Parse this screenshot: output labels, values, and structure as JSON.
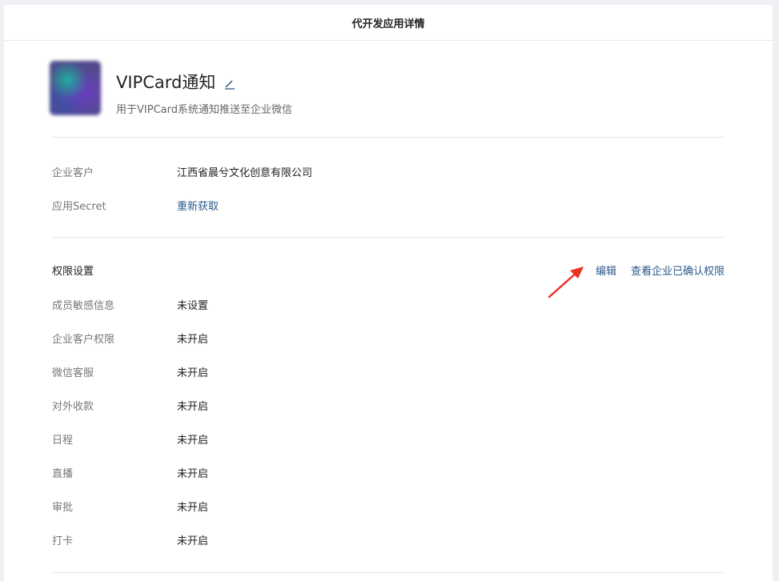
{
  "header": {
    "title": "代开发应用详情"
  },
  "app": {
    "name": "VIPCard通知",
    "description": "用于VIPCard系统通知推送至企业微信"
  },
  "info": [
    {
      "label": "企业客户",
      "value": "江西省晨兮文化创意有限公司",
      "link": false
    },
    {
      "label": "应用Secret",
      "value": "重新获取",
      "link": true
    }
  ],
  "permissions": {
    "title": "权限设置",
    "edit_label": "编辑",
    "view_label": "查看企业已确认权限",
    "items": [
      {
        "label": "成员敏感信息",
        "value": "未设置"
      },
      {
        "label": "企业客户权限",
        "value": "未开启"
      },
      {
        "label": "微信客服",
        "value": "未开启"
      },
      {
        "label": "对外收款",
        "value": "未开启"
      },
      {
        "label": "日程",
        "value": "未开启"
      },
      {
        "label": "直播",
        "value": "未开启"
      },
      {
        "label": "审批",
        "value": "未开启"
      },
      {
        "label": "打卡",
        "value": "未开启"
      }
    ]
  },
  "colors": {
    "link": "#2a5a8a",
    "annotation_arrow": "#e8311f"
  }
}
